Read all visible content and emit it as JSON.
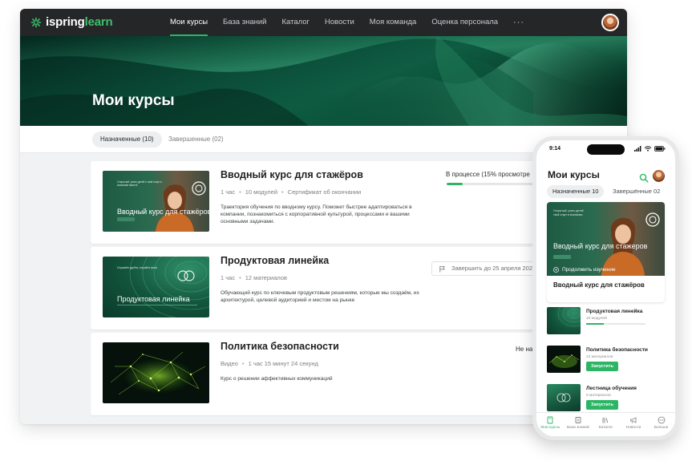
{
  "app": {
    "logo_text": "ispring",
    "logo_accent": "learn",
    "accent_color": "#2db566"
  },
  "nav": {
    "items": [
      {
        "label": "Мои курсы",
        "active": true
      },
      {
        "label": "База знаний"
      },
      {
        "label": "Каталог"
      },
      {
        "label": "Новости"
      },
      {
        "label": "Моя команда"
      },
      {
        "label": "Оценка персонала"
      }
    ],
    "more": "···"
  },
  "hero": {
    "title": "Мои курсы"
  },
  "tabs": [
    {
      "label": "Назначенные (10)",
      "active": true
    },
    {
      "label": "Завершенные (02)"
    }
  ],
  "courses": [
    {
      "thumb_label": "Вводный курс для стажёров",
      "thumb_small": "Открытый, учить детей с твой старт в компании вместе",
      "title": "Вводный курс для стажёров",
      "meta": [
        "1 час",
        "10 модулей",
        "Сертификат об окончании"
      ],
      "description": "Траектория обучения по вводному курсу. Поможет быстрее адаптироваться в компании, познакомиться с корпоративной культурой, процессами и вашими основными задачами.",
      "status": "В процессе (15% просмотре",
      "progress": 0.15
    },
    {
      "thumb_label": "Продуктовая линейка",
      "thumb_small": "Слушайте удобно, изучайте фичи",
      "title": "Продуктовая линейка",
      "meta": [
        "1 час",
        "12 материалов"
      ],
      "description": "Обучающий курс по ключевым продуктовым решениям, которые мы создаём, их архитектурой, целевой аудиторией и местом на рынке",
      "deadline": "Завершить до 25 апреля 202"
    },
    {
      "title": "Политика безопасности",
      "meta": [
        "Видео",
        "1 час 15 минут 24 секунд"
      ],
      "description": "Курс о решении аффективных коммуникаций",
      "status": "Не на"
    }
  ],
  "phone": {
    "time": "9:14",
    "title": "Мои курсы",
    "tabs": [
      {
        "label": "Назначенные 10",
        "active": true
      },
      {
        "label": "Завершённые 02"
      }
    ],
    "hero": {
      "thumb_label": "Вводный курс для стажеров",
      "continue_label": "Продолжить изучение",
      "name": "Вводный курс для стажёров"
    },
    "items": [
      {
        "title": "Продуктовая линейка",
        "sub": "10 модулей",
        "progress": 0.3
      },
      {
        "title": "Политика безопасности",
        "sub": "12 материалов",
        "button": "Запустить"
      },
      {
        "title": "Лестница обучения",
        "sub": "8 материалов",
        "button": "Запустить"
      }
    ],
    "bottom_nav": [
      {
        "label": "Мои курсы",
        "icon": "book-icon",
        "active": true
      },
      {
        "label": "База знаний",
        "icon": "library-icon"
      },
      {
        "label": "Каталог",
        "icon": "catalog-icon"
      },
      {
        "label": "Новости",
        "icon": "megaphone-icon"
      },
      {
        "label": "Больше",
        "icon": "more-icon"
      }
    ]
  }
}
